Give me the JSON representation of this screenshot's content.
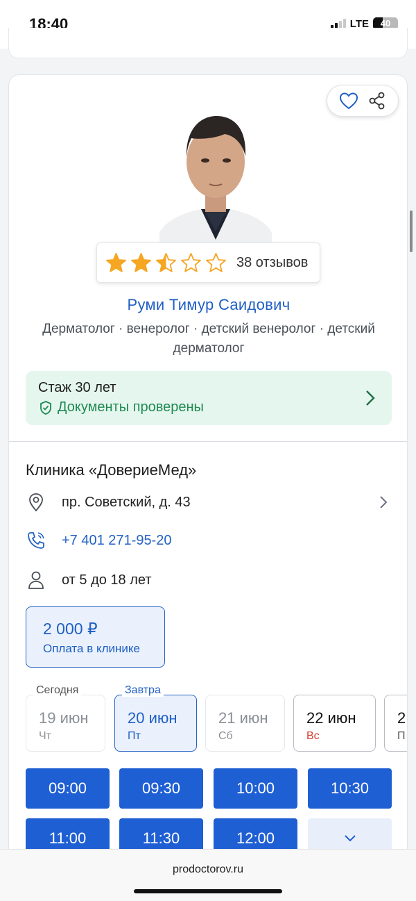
{
  "status_bar": {
    "time": "18:40",
    "network": "LTE",
    "battery": "40",
    "battery_level": 0.4
  },
  "doctor": {
    "name": "Руми Тимур Саидович",
    "specialties": "Дерматолог · венеролог · детский венеролог · детский дерматолог",
    "rating_stars": 2.5,
    "reviews": "38 отзывов",
    "experience": "Стаж 30 лет",
    "verified": "Документы проверены"
  },
  "actions": {
    "favorite_icon": "heart-icon",
    "share_icon": "share-icon"
  },
  "clinic": {
    "name": "Клиника «ДовериеМед»",
    "address": "пр. Советский, д. 43",
    "phone": "+7 401 271-95-20",
    "age": "от 5 до 18 лет",
    "price": "2 000 ₽",
    "payment": "Оплата в клинике"
  },
  "dates": [
    {
      "label": "Сегодня",
      "day": "19 июн",
      "weekday": "Чт",
      "state": "disabled"
    },
    {
      "label": "Завтра",
      "day": "20 июн",
      "weekday": "Пт",
      "state": "selected"
    },
    {
      "label": "",
      "day": "21 июн",
      "weekday": "Сб",
      "state": "disabled"
    },
    {
      "label": "",
      "day": "22 июн",
      "weekday": "Вс",
      "state": "available"
    },
    {
      "label": "",
      "day": "2",
      "weekday": "П",
      "state": "partial"
    }
  ],
  "slots": [
    "09:00",
    "09:30",
    "10:00",
    "10:30",
    "11:00",
    "11:30",
    "12:00"
  ],
  "browser": {
    "url": "prodoctorov.ru"
  },
  "colors": {
    "brand_blue": "#1f5fd4",
    "link_blue": "#2462c4",
    "green": "#1f8a52",
    "star": "#f5a623",
    "sunday_red": "#d53b2f"
  }
}
